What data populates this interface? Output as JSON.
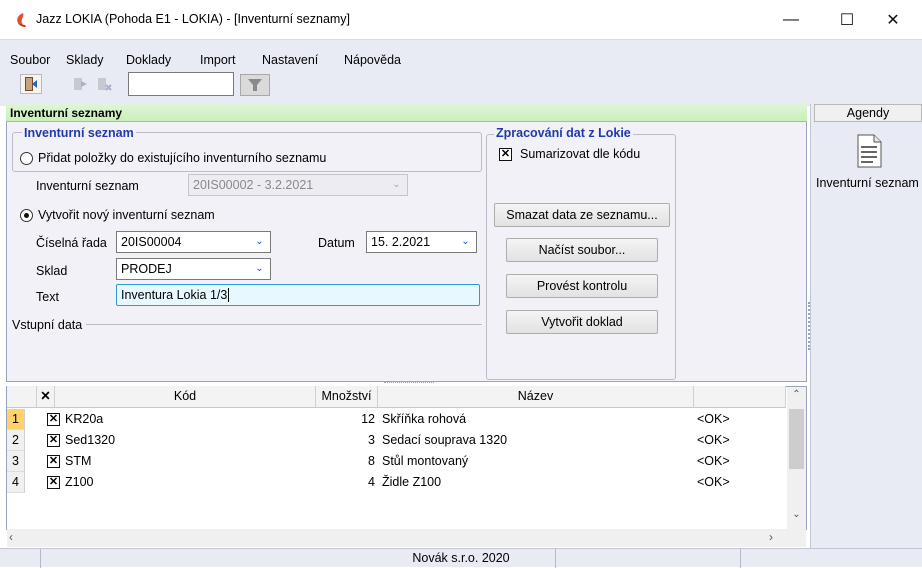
{
  "window": {
    "title": "Jazz LOKIA (Pohoda E1 - LOKIA) - [Inventurní seznamy]",
    "minimize": "—",
    "maximize": "☐",
    "close": "✕"
  },
  "menu": [
    "Soubor",
    "Sklady",
    "Doklady",
    "Import",
    "Nastavení",
    "Nápověda"
  ],
  "toolbar": {
    "search_value": ""
  },
  "section": {
    "title": "Inventurní seznamy"
  },
  "inventory": {
    "group_title": "Inventurní seznam",
    "option_existing": "Přidat položky do existujícího inventurního seznamu",
    "existing_label": "Inventurní seznam",
    "existing_value": "20IS00002 - 3.2.2021",
    "option_new": "Vytvořit nový inventurní seznam",
    "series_label": "Číselná řada",
    "series_value": "20IS00004",
    "date_label": "Datum",
    "date_value": "15. 2.2021",
    "store_label": "Sklad",
    "store_value": "PRODEJ",
    "text_label": "Text",
    "text_value": "Inventura Lokia 1/3",
    "input_data_label": "Vstupní data"
  },
  "processing": {
    "group_title": "Zpracování dat z Lokie",
    "summarize_label": "Sumarizovat dle kódu",
    "summarize_checked": true,
    "buttons": {
      "delete": "Smazat data ze seznamu...",
      "load": "Načíst soubor...",
      "check": "Provést kontrolu",
      "create": "Vytvořit doklad"
    }
  },
  "agendy": {
    "header": "Agendy",
    "item": "Inventurní seznam"
  },
  "grid": {
    "columns": {
      "check": "✕",
      "code": "Kód",
      "qty": "Množství",
      "name": "Název"
    },
    "rows": [
      {
        "num": "1",
        "code": "KR20a",
        "qty": "12",
        "name": "Skříňka rohová",
        "status": "<OK>"
      },
      {
        "num": "2",
        "code": "Sed1320",
        "qty": "3",
        "name": "Sedací souprava 1320",
        "status": "<OK>"
      },
      {
        "num": "3",
        "code": "STM",
        "qty": "8",
        "name": "Stůl montovaný",
        "status": "<OK>"
      },
      {
        "num": "4",
        "code": "Z100",
        "qty": "4",
        "name": "Židle Z100",
        "status": "<OK>"
      }
    ]
  },
  "status": {
    "company": "Novák s.r.o. 2020"
  }
}
